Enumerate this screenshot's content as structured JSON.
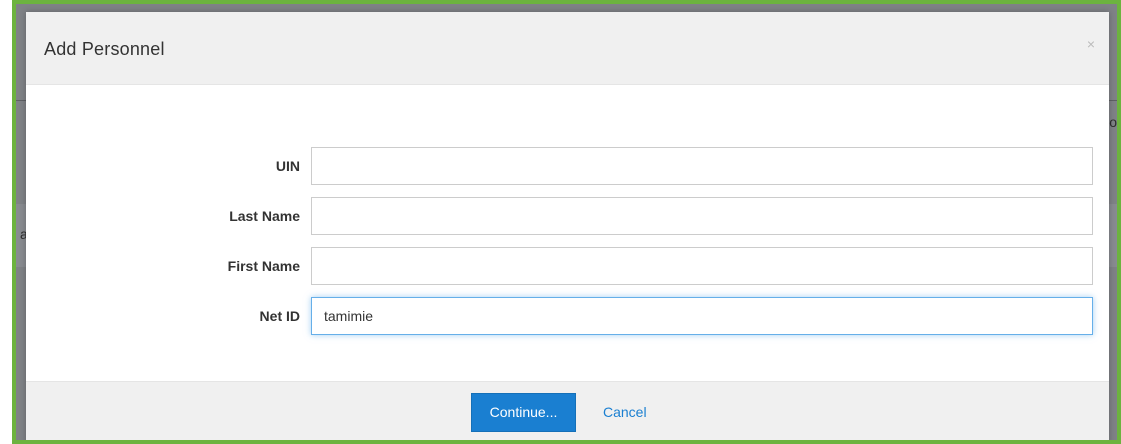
{
  "dialog": {
    "title": "Add Personnel",
    "close_glyph": "×",
    "close_icon": "close-icon"
  },
  "form": {
    "fields": [
      {
        "label": "UIN",
        "value": "",
        "placeholder": ""
      },
      {
        "label": "Last Name",
        "value": "",
        "placeholder": ""
      },
      {
        "label": "First Name",
        "value": "",
        "placeholder": ""
      },
      {
        "label": "Net ID",
        "value": "tamimie",
        "placeholder": ""
      }
    ]
  },
  "footer": {
    "continue_label": "Continue...",
    "cancel_label": "Cancel"
  },
  "background": {
    "left_glyph": "a",
    "right_glyph": "o"
  },
  "colors": {
    "frame_border": "#6cb33f",
    "primary": "#1a7fd1",
    "overlay": "#7f8286"
  }
}
